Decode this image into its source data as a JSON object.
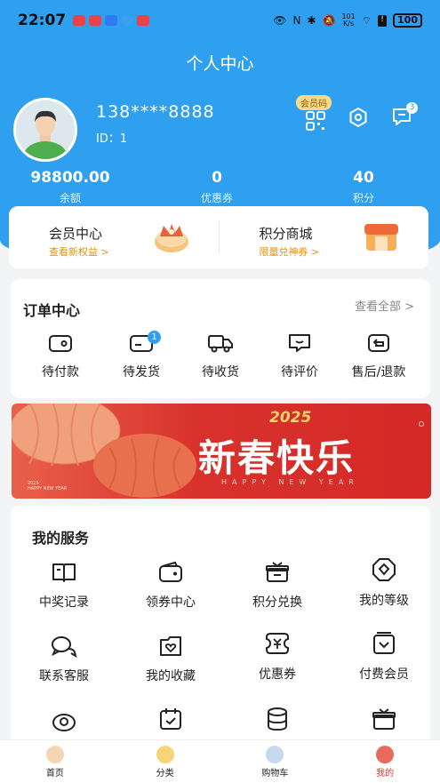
{
  "status_bar": {
    "time": "22:07",
    "network_speed": "101\nK/s",
    "battery": "100",
    "app_colors": [
      "#e5454a",
      "#e5454a",
      "#2f7cf0",
      "#3aa0f0",
      "#e5454a"
    ]
  },
  "header": {
    "title": "个人中心"
  },
  "profile": {
    "phone": "138****8888",
    "id_label": "ID：1",
    "member_code_label": "会员码",
    "message_count": "3"
  },
  "stats": [
    {
      "value": "98800.00",
      "label": "余额"
    },
    {
      "value": "0",
      "label": "优惠券"
    },
    {
      "value": "40",
      "label": "积分"
    }
  ],
  "promo": [
    {
      "title": "会员中心",
      "subtitle": "查看新权益 >"
    },
    {
      "title": "积分商城",
      "subtitle": "限量兑神券 >"
    }
  ],
  "orders": {
    "title": "订单中心",
    "view_all": "查看全部 >",
    "items": [
      {
        "label": "待付款",
        "icon": "wallet-icon",
        "badge": ""
      },
      {
        "label": "待发货",
        "icon": "card-icon",
        "badge": "1"
      },
      {
        "label": "待收货",
        "icon": "truck-icon",
        "badge": ""
      },
      {
        "label": "待评价",
        "icon": "comment-icon",
        "badge": ""
      },
      {
        "label": "售后/退款",
        "icon": "return-icon",
        "badge": ""
      }
    ]
  },
  "banner": {
    "year": "2025",
    "text": "新春快乐",
    "subtitle": "HAPPY NEW YEAR",
    "small_text": "2025\nHAPPY NEW YEAR"
  },
  "services": {
    "title": "我的服务",
    "items": [
      {
        "label": "中奖记录",
        "icon": "book-icon"
      },
      {
        "label": "领券中心",
        "icon": "wallet-icon"
      },
      {
        "label": "积分兑换",
        "icon": "gift-icon"
      },
      {
        "label": "我的等级",
        "icon": "level-icon"
      },
      {
        "label": "联系客服",
        "icon": "chat-icon"
      },
      {
        "label": "我的收藏",
        "icon": "heart-box-icon"
      },
      {
        "label": "优惠券",
        "icon": "coupon-icon"
      },
      {
        "label": "付费会员",
        "icon": "vip-icon"
      },
      {
        "label": "",
        "icon": "location-icon"
      },
      {
        "label": "",
        "icon": "calendar-icon"
      },
      {
        "label": "",
        "icon": "database-icon"
      },
      {
        "label": "",
        "icon": "gift-icon"
      }
    ]
  },
  "tabbar": [
    {
      "label": "首页",
      "active": false
    },
    {
      "label": "分类",
      "active": false
    },
    {
      "label": "购物车",
      "active": false
    },
    {
      "label": "我的",
      "active": true
    }
  ],
  "colors": {
    "primary": "#2f9ff0",
    "accent_orange": "#e8920c",
    "active_red": "#e0342c"
  }
}
